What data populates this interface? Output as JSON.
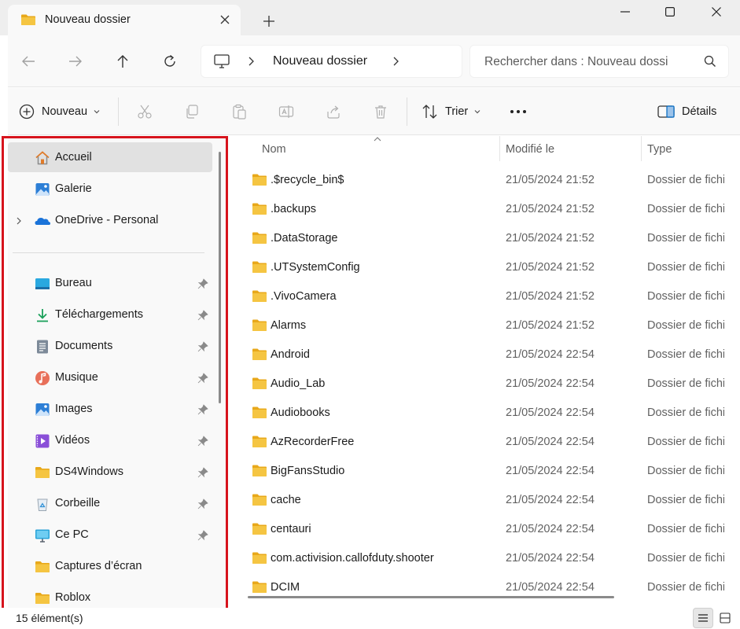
{
  "tab": {
    "title": "Nouveau dossier"
  },
  "address": {
    "location": "Nouveau dossier"
  },
  "search": {
    "placeholder": "Rechercher dans : Nouveau dossi"
  },
  "commandbar": {
    "new_label": "Nouveau",
    "sort_label": "Trier",
    "details_label": "Détails",
    "more_label": "•••"
  },
  "sidebar": {
    "items": [
      {
        "label": "Accueil",
        "icon": "home-icon",
        "selected": true
      },
      {
        "label": "Galerie",
        "icon": "gallery-icon"
      },
      {
        "label": "OneDrive - Personal",
        "icon": "onedrive-icon",
        "expandable": true
      },
      {
        "label": "Bureau",
        "icon": "desktop-icon",
        "pinned": true
      },
      {
        "label": "Téléchargements",
        "icon": "download-icon",
        "pinned": true
      },
      {
        "label": "Documents",
        "icon": "documents-icon",
        "pinned": true
      },
      {
        "label": "Musique",
        "icon": "music-icon",
        "pinned": true
      },
      {
        "label": "Images",
        "icon": "images-icon",
        "pinned": true
      },
      {
        "label": "Vidéos",
        "icon": "videos-icon",
        "pinned": true
      },
      {
        "label": "DS4Windows",
        "icon": "folder-icon",
        "pinned": true
      },
      {
        "label": "Corbeille",
        "icon": "recycle-bin-icon",
        "pinned": true
      },
      {
        "label": "Ce PC",
        "icon": "computer-icon",
        "pinned": true
      },
      {
        "label": "Captures d’écran",
        "icon": "folder-icon"
      },
      {
        "label": "Roblox",
        "icon": "folder-icon"
      }
    ]
  },
  "columns": {
    "name": "Nom",
    "modified": "Modifié le",
    "type": "Type"
  },
  "files": [
    {
      "name": ".$recycle_bin$",
      "modified": "21/05/2024 21:52",
      "type": "Dossier de fichiers"
    },
    {
      "name": ".backups",
      "modified": "21/05/2024 21:52",
      "type": "Dossier de fichiers"
    },
    {
      "name": ".DataStorage",
      "modified": "21/05/2024 21:52",
      "type": "Dossier de fichiers"
    },
    {
      "name": ".UTSystemConfig",
      "modified": "21/05/2024 21:52",
      "type": "Dossier de fichiers"
    },
    {
      "name": ".VivoCamera",
      "modified": "21/05/2024 21:52",
      "type": "Dossier de fichiers"
    },
    {
      "name": "Alarms",
      "modified": "21/05/2024 21:52",
      "type": "Dossier de fichiers"
    },
    {
      "name": "Android",
      "modified": "21/05/2024 22:54",
      "type": "Dossier de fichiers"
    },
    {
      "name": "Audio_Lab",
      "modified": "21/05/2024 22:54",
      "type": "Dossier de fichiers"
    },
    {
      "name": "Audiobooks",
      "modified": "21/05/2024 22:54",
      "type": "Dossier de fichiers"
    },
    {
      "name": "AzRecorderFree",
      "modified": "21/05/2024 22:54",
      "type": "Dossier de fichiers"
    },
    {
      "name": "BigFansStudio",
      "modified": "21/05/2024 22:54",
      "type": "Dossier de fichiers"
    },
    {
      "name": "cache",
      "modified": "21/05/2024 22:54",
      "type": "Dossier de fichiers"
    },
    {
      "name": "centauri",
      "modified": "21/05/2024 22:54",
      "type": "Dossier de fichiers"
    },
    {
      "name": "com.activision.callofduty.shooter",
      "modified": "21/05/2024 22:54",
      "type": "Dossier de fichiers"
    },
    {
      "name": "DCIM",
      "modified": "21/05/2024 22:54",
      "type": "Dossier de fichiers"
    }
  ],
  "status": {
    "count": "15 élément(s)"
  },
  "colors": {
    "folder": "#f5c542",
    "accent": "#0067c0",
    "highlight_border": "#d7141d"
  }
}
